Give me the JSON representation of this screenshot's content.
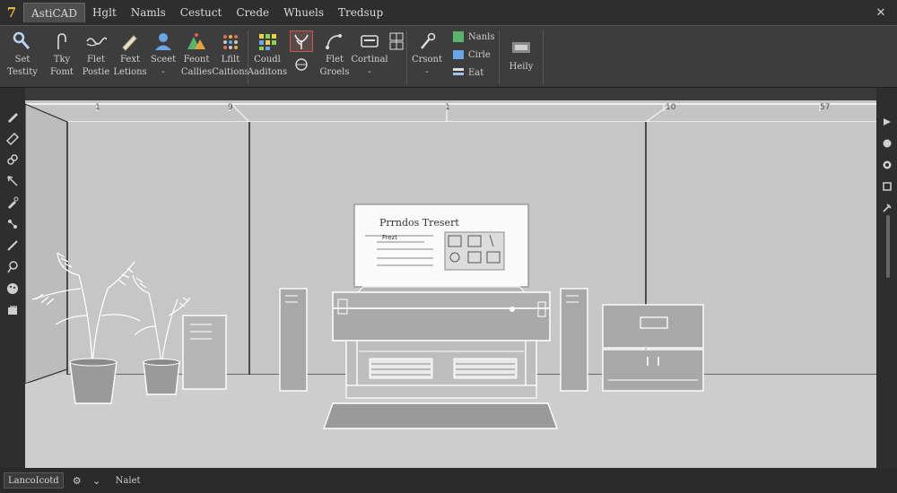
{
  "menubar": {
    "items": [
      "AstiCAD",
      "Hglt",
      "Namls",
      "Cestuct",
      "Crede",
      "Whuels",
      "Tredsup"
    ],
    "active_index": 0
  },
  "ribbon": {
    "tools": [
      {
        "label": "Set\nTestity",
        "icon": "wrench-icon"
      },
      {
        "label": "Tky\nFomt",
        "icon": "fork-icon"
      },
      {
        "label": "Flet\nPostie",
        "icon": "wave-icon"
      },
      {
        "label": "Fext\nLetions",
        "icon": "pen-icon"
      },
      {
        "label": "Sceet\n-",
        "icon": "user-icon"
      },
      {
        "label": "Feont\nCallies",
        "icon": "triangles-icon"
      },
      {
        "label": "Lfilt\nCaitions",
        "icon": "dots-grid-icon"
      },
      {
        "label": "Coudl\nAaditons",
        "icon": "color-grid-icon"
      },
      {
        "label": "",
        "icon": "plant-icon"
      },
      {
        "label": "Flet\nGroels",
        "icon": "arc-icon"
      },
      {
        "label": "Cortinal\n-",
        "icon": "card-icon"
      },
      {
        "label": "",
        "icon": "grid-panel-icon"
      },
      {
        "label": "Crsont\n-",
        "icon": "brush-icon"
      }
    ],
    "stack": [
      {
        "label": "Nanls",
        "icon": "green-square-icon"
      },
      {
        "label": "Cirle",
        "icon": "blue-square-icon"
      },
      {
        "label": "Eat",
        "icon": "stack-icon"
      }
    ],
    "help": {
      "label": "Heily",
      "icon": "display-icon"
    }
  },
  "ruler": {
    "labels": [
      "1",
      "9",
      "1",
      "10",
      "57"
    ]
  },
  "scene": {
    "monitor_title": "Prrndos Tresert",
    "monitor_line": "Frezt"
  },
  "statusbar": {
    "layout_field": "LancoIcotd",
    "icon": "gear-icon",
    "dropdown": "⌄",
    "mode": "Nalet"
  },
  "colors": {
    "menubar": "#2e2e2e",
    "ribbon": "#3d3d3d",
    "viewport": "#c9c9c9",
    "line": "#ffffff"
  }
}
